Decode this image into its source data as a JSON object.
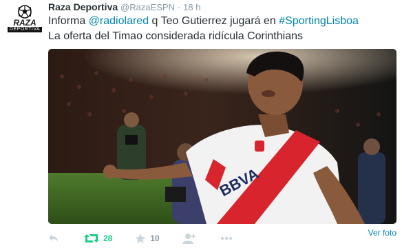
{
  "account": {
    "avatar_brand": "RAZA",
    "avatar_sub": "DEPORTIVA",
    "name": "Raza Deportiva",
    "handle": "@RazaESPN",
    "separator": "·",
    "time": "18 h"
  },
  "tweet": {
    "part1": "Informa ",
    "mention": "@radiolared",
    "part2": " q Teo Gutierrez jugará en ",
    "hashtag": "#SportingLisboa",
    "line2": "La oferta del Timao considerada ridícula  Corinthians"
  },
  "photo": {
    "jersey_text": "BBVA"
  },
  "media": {
    "see_photo": "Ver foto"
  },
  "actions": {
    "reply_icon": "reply-icon",
    "retweet_icon": "retweet-icon",
    "retweet_count": "28",
    "favorite_icon": "star-icon",
    "favorite_count": "10",
    "follow_icon": "add-user-icon",
    "more_icon": "more-icon"
  },
  "colors": {
    "link": "#0084b4",
    "retweet_active": "#19cf86",
    "muted": "#8899a6",
    "text": "#292f33",
    "jersey_stripe": "#d8242c"
  }
}
